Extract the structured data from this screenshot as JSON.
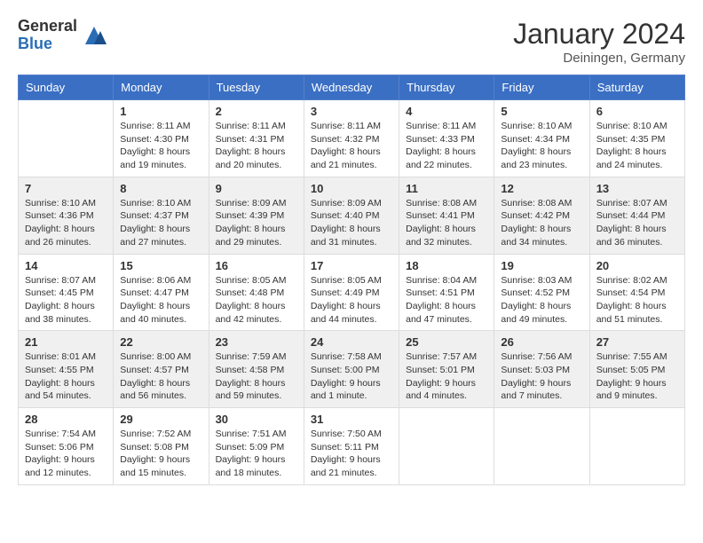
{
  "logo": {
    "general": "General",
    "blue": "Blue"
  },
  "title": "January 2024",
  "location": "Deiningen, Germany",
  "weekdays": [
    "Sunday",
    "Monday",
    "Tuesday",
    "Wednesday",
    "Thursday",
    "Friday",
    "Saturday"
  ],
  "weeks": [
    [
      {
        "num": "",
        "info": ""
      },
      {
        "num": "1",
        "info": "Sunrise: 8:11 AM\nSunset: 4:30 PM\nDaylight: 8 hours\nand 19 minutes."
      },
      {
        "num": "2",
        "info": "Sunrise: 8:11 AM\nSunset: 4:31 PM\nDaylight: 8 hours\nand 20 minutes."
      },
      {
        "num": "3",
        "info": "Sunrise: 8:11 AM\nSunset: 4:32 PM\nDaylight: 8 hours\nand 21 minutes."
      },
      {
        "num": "4",
        "info": "Sunrise: 8:11 AM\nSunset: 4:33 PM\nDaylight: 8 hours\nand 22 minutes."
      },
      {
        "num": "5",
        "info": "Sunrise: 8:10 AM\nSunset: 4:34 PM\nDaylight: 8 hours\nand 23 minutes."
      },
      {
        "num": "6",
        "info": "Sunrise: 8:10 AM\nSunset: 4:35 PM\nDaylight: 8 hours\nand 24 minutes."
      }
    ],
    [
      {
        "num": "7",
        "info": "Sunrise: 8:10 AM\nSunset: 4:36 PM\nDaylight: 8 hours\nand 26 minutes."
      },
      {
        "num": "8",
        "info": "Sunrise: 8:10 AM\nSunset: 4:37 PM\nDaylight: 8 hours\nand 27 minutes."
      },
      {
        "num": "9",
        "info": "Sunrise: 8:09 AM\nSunset: 4:39 PM\nDaylight: 8 hours\nand 29 minutes."
      },
      {
        "num": "10",
        "info": "Sunrise: 8:09 AM\nSunset: 4:40 PM\nDaylight: 8 hours\nand 31 minutes."
      },
      {
        "num": "11",
        "info": "Sunrise: 8:08 AM\nSunset: 4:41 PM\nDaylight: 8 hours\nand 32 minutes."
      },
      {
        "num": "12",
        "info": "Sunrise: 8:08 AM\nSunset: 4:42 PM\nDaylight: 8 hours\nand 34 minutes."
      },
      {
        "num": "13",
        "info": "Sunrise: 8:07 AM\nSunset: 4:44 PM\nDaylight: 8 hours\nand 36 minutes."
      }
    ],
    [
      {
        "num": "14",
        "info": "Sunrise: 8:07 AM\nSunset: 4:45 PM\nDaylight: 8 hours\nand 38 minutes."
      },
      {
        "num": "15",
        "info": "Sunrise: 8:06 AM\nSunset: 4:47 PM\nDaylight: 8 hours\nand 40 minutes."
      },
      {
        "num": "16",
        "info": "Sunrise: 8:05 AM\nSunset: 4:48 PM\nDaylight: 8 hours\nand 42 minutes."
      },
      {
        "num": "17",
        "info": "Sunrise: 8:05 AM\nSunset: 4:49 PM\nDaylight: 8 hours\nand 44 minutes."
      },
      {
        "num": "18",
        "info": "Sunrise: 8:04 AM\nSunset: 4:51 PM\nDaylight: 8 hours\nand 47 minutes."
      },
      {
        "num": "19",
        "info": "Sunrise: 8:03 AM\nSunset: 4:52 PM\nDaylight: 8 hours\nand 49 minutes."
      },
      {
        "num": "20",
        "info": "Sunrise: 8:02 AM\nSunset: 4:54 PM\nDaylight: 8 hours\nand 51 minutes."
      }
    ],
    [
      {
        "num": "21",
        "info": "Sunrise: 8:01 AM\nSunset: 4:55 PM\nDaylight: 8 hours\nand 54 minutes."
      },
      {
        "num": "22",
        "info": "Sunrise: 8:00 AM\nSunset: 4:57 PM\nDaylight: 8 hours\nand 56 minutes."
      },
      {
        "num": "23",
        "info": "Sunrise: 7:59 AM\nSunset: 4:58 PM\nDaylight: 8 hours\nand 59 minutes."
      },
      {
        "num": "24",
        "info": "Sunrise: 7:58 AM\nSunset: 5:00 PM\nDaylight: 9 hours\nand 1 minute."
      },
      {
        "num": "25",
        "info": "Sunrise: 7:57 AM\nSunset: 5:01 PM\nDaylight: 9 hours\nand 4 minutes."
      },
      {
        "num": "26",
        "info": "Sunrise: 7:56 AM\nSunset: 5:03 PM\nDaylight: 9 hours\nand 7 minutes."
      },
      {
        "num": "27",
        "info": "Sunrise: 7:55 AM\nSunset: 5:05 PM\nDaylight: 9 hours\nand 9 minutes."
      }
    ],
    [
      {
        "num": "28",
        "info": "Sunrise: 7:54 AM\nSunset: 5:06 PM\nDaylight: 9 hours\nand 12 minutes."
      },
      {
        "num": "29",
        "info": "Sunrise: 7:52 AM\nSunset: 5:08 PM\nDaylight: 9 hours\nand 15 minutes."
      },
      {
        "num": "30",
        "info": "Sunrise: 7:51 AM\nSunset: 5:09 PM\nDaylight: 9 hours\nand 18 minutes."
      },
      {
        "num": "31",
        "info": "Sunrise: 7:50 AM\nSunset: 5:11 PM\nDaylight: 9 hours\nand 21 minutes."
      },
      {
        "num": "",
        "info": ""
      },
      {
        "num": "",
        "info": ""
      },
      {
        "num": "",
        "info": ""
      }
    ]
  ]
}
